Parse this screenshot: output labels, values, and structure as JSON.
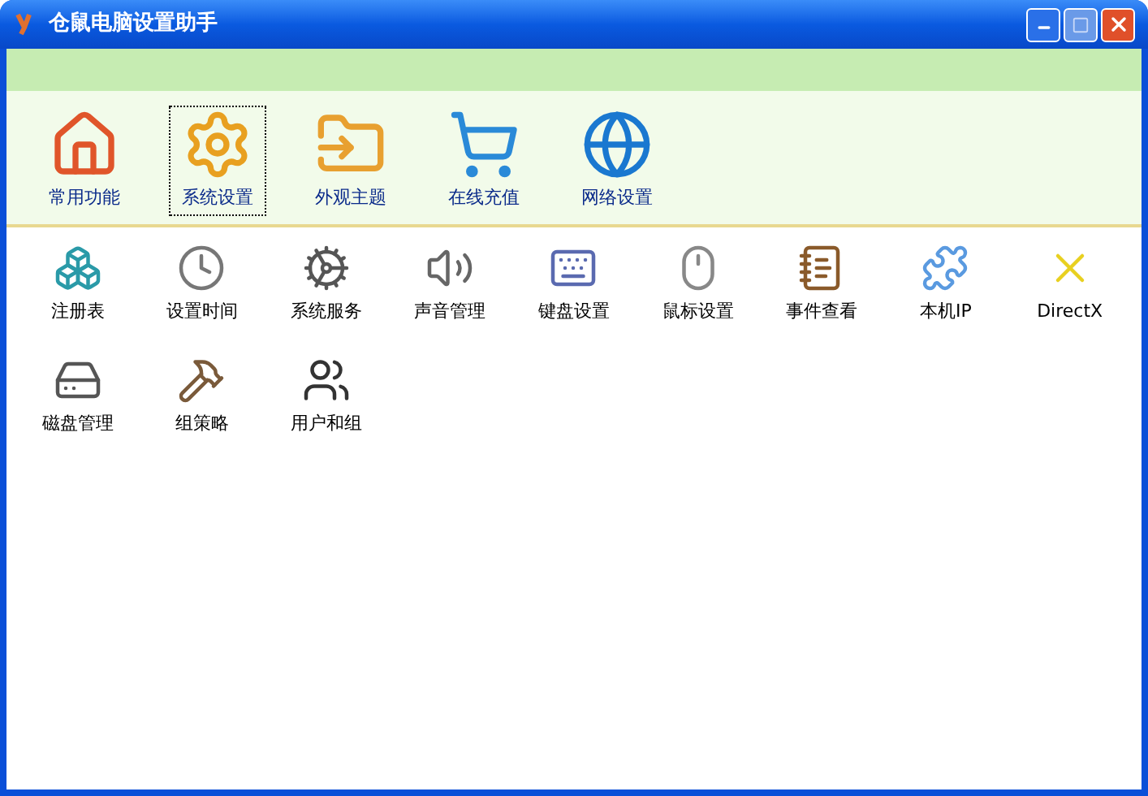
{
  "window": {
    "title": "仓鼠电脑设置助手"
  },
  "toolbar": [
    {
      "label": "常用功能",
      "selected": false
    },
    {
      "label": "系统设置",
      "selected": true
    },
    {
      "label": "外观主题",
      "selected": false
    },
    {
      "label": "在线充值",
      "selected": false
    },
    {
      "label": "网络设置",
      "selected": false
    }
  ],
  "tools": [
    {
      "label": "注册表"
    },
    {
      "label": "设置时间"
    },
    {
      "label": "系统服务"
    },
    {
      "label": "声音管理"
    },
    {
      "label": "键盘设置"
    },
    {
      "label": "鼠标设置"
    },
    {
      "label": "事件查看"
    },
    {
      "label": "本机IP"
    },
    {
      "label": "DirectX"
    },
    {
      "label": "磁盘管理"
    },
    {
      "label": "组策略"
    },
    {
      "label": "用户和组"
    }
  ]
}
